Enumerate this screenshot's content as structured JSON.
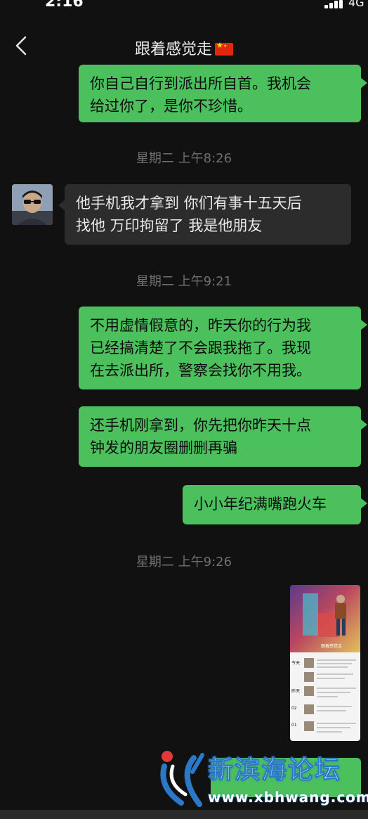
{
  "status": {
    "time": "2:16",
    "network": "4G"
  },
  "nav": {
    "title": "跟着感觉走",
    "back_icon": "chevron-left-icon"
  },
  "messages": [
    {
      "side": "out",
      "line1": "你自己自行到派出所自首。我机会",
      "line2": "给过你了，是你不珍惜。"
    },
    {
      "timestamp": "星期二 上午8:26"
    },
    {
      "side": "in",
      "line1": "他手机我才拿到 你们有事十五天后",
      "line2": "找他 万印拘留了 我是他朋友"
    },
    {
      "timestamp": "星期二 上午9:21"
    },
    {
      "side": "out",
      "line1": "不用虚情假意的，昨天你的行为我",
      "line2": "已经搞清楚了不会跟我拖了。我现",
      "line3": "在去派出所，警察会找你不用我。"
    },
    {
      "side": "out",
      "line1": "还手机刚拿到，你先把你昨天十点",
      "line2": "钟发的朋友圈删删再骗"
    },
    {
      "side": "out",
      "line1": "小小年纪满嘴跑火车"
    },
    {
      "timestamp": "星期二 上午9:26"
    },
    {
      "side": "out",
      "type": "image"
    }
  ],
  "thumbnail": {
    "profile_name": "跟着感觉走",
    "rows": [
      "今天",
      "昨天",
      "02",
      "01"
    ]
  },
  "watermark": {
    "name": "新滨海论坛",
    "url": "www.xbhwang.com"
  },
  "colors": {
    "outgoing_bubble": "#4bc05c",
    "incoming_bubble": "#2c2c2c",
    "background": "#111111",
    "timestamp": "#6f6f6f"
  }
}
